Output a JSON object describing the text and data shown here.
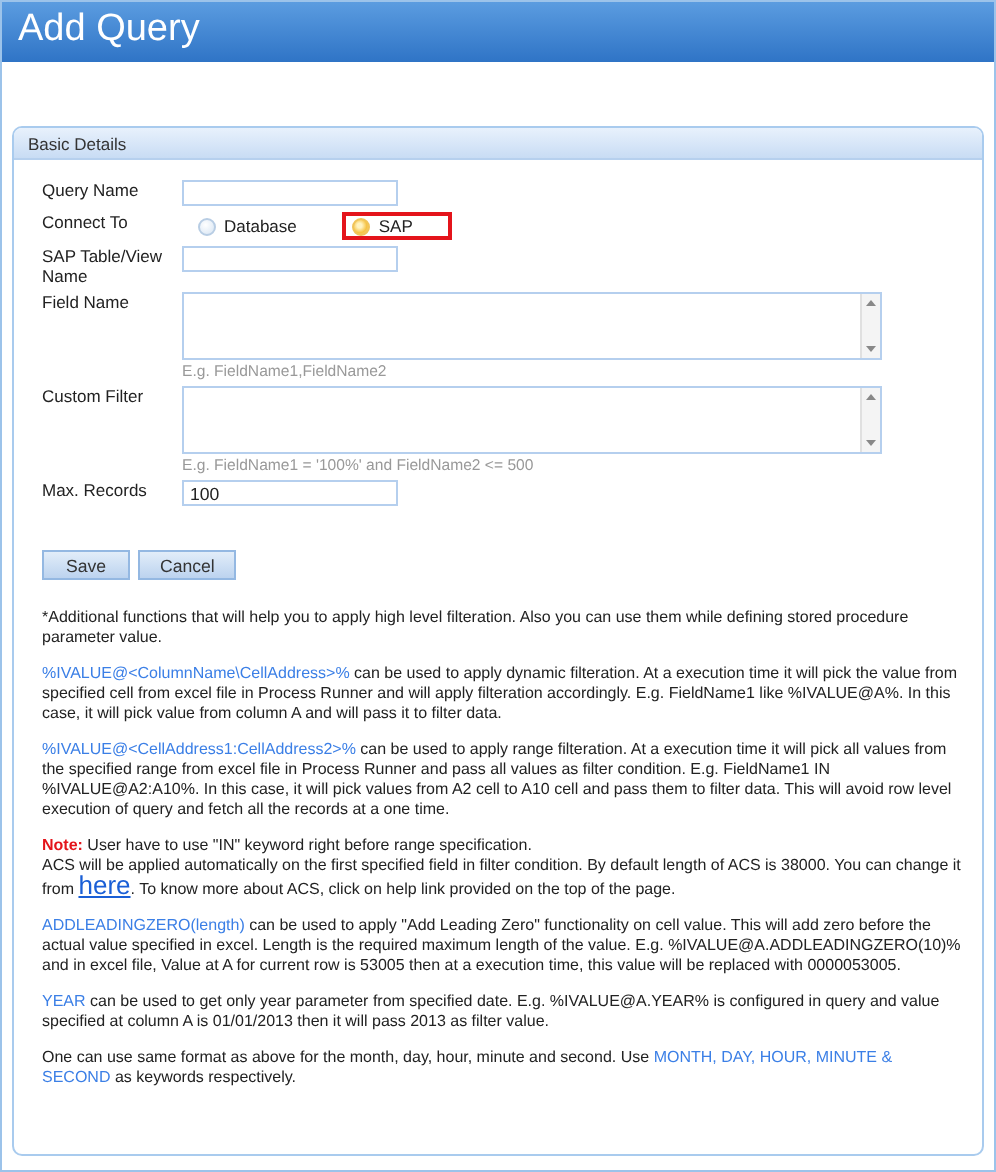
{
  "header": {
    "title": "Add Query"
  },
  "panel": {
    "title": "Basic Details"
  },
  "form": {
    "fields": [
      {
        "kind": "text",
        "label": "Query Name"
      },
      {
        "kind": "radio",
        "label": "Connect To",
        "options": [
          {
            "label": "Database",
            "selected": false,
            "highlighted": false
          },
          {
            "label": "SAP",
            "selected": true,
            "highlighted": true
          }
        ]
      },
      {
        "kind": "text",
        "label": "SAP Table/View Name"
      },
      {
        "kind": "textarea",
        "label": "Field Name",
        "hint": "E.g. FieldName1,FieldName2"
      },
      {
        "kind": "textarea",
        "label": "Custom Filter",
        "hint": "E.g. FieldName1 = '100%' and FieldName2 <= 500"
      },
      {
        "kind": "text",
        "label": "Max. Records",
        "value": "100"
      }
    ],
    "buttons": [
      "Save",
      "Cancel"
    ]
  },
  "notes": [
    {
      "segments": [
        {
          "kind": "plain",
          "text": "*Additional functions that will help you to apply high level filteration. Also you can use them while defining stored procedure parameter value."
        }
      ]
    },
    {
      "segments": [
        {
          "kind": "keyword",
          "text": "%IVALUE@<ColumnName\\CellAddress>%"
        },
        {
          "kind": "plain",
          "text": " can be used to apply dynamic filteration. At a execution time it will pick the value from specified cell from excel file in Process Runner and will apply filteration accordingly. E.g. FieldName1 like %IVALUE@A%. In this case, it will pick value from column A and will pass it to filter data."
        }
      ]
    },
    {
      "segments": [
        {
          "kind": "keyword",
          "text": "%IVALUE@<CellAddress1:CellAddress2>%"
        },
        {
          "kind": "plain",
          "text": " can be used to apply range filteration. At a execution time it will pick all values from the specified range from excel file in Process Runner and pass all values as filter condition. E.g. FieldName1 IN %IVALUE@A2:A10%. In this case, it will pick values from A2 cell to A10 cell and pass them to filter data. This will avoid row level execution of query and fetch all the records at a one time."
        }
      ]
    },
    {
      "segments": [
        {
          "kind": "note",
          "text": "Note:"
        },
        {
          "kind": "plain",
          "text": " User have to use \"IN\" keyword right before range specification."
        },
        {
          "kind": "break"
        },
        {
          "kind": "plain",
          "text": "ACS will be applied automatically on the first specified field in filter condition. By default length of ACS is 38000. You can change it from "
        },
        {
          "kind": "link",
          "text": "here"
        },
        {
          "kind": "plain",
          "text": ". To know more about ACS, click on help link provided on the top of the page."
        }
      ]
    },
    {
      "segments": [
        {
          "kind": "keyword",
          "text": "ADDLEADINGZERO(length)"
        },
        {
          "kind": "plain",
          "text": " can be used to apply \"Add Leading Zero\" functionality on cell value. This will add zero before the actual value specified in excel. Length is the required maximum length of the value. E.g. %IVALUE@A.ADDLEADINGZERO(10)% and in excel file, Value at A for current row is 53005 then at a execution time, this value will be replaced with 0000053005."
        }
      ]
    },
    {
      "segments": [
        {
          "kind": "keyword",
          "text": "YEAR"
        },
        {
          "kind": "plain",
          "text": " can be used to get only year parameter from specified date. E.g. %IVALUE@A.YEAR% is configured in query and value specified at column A is 01/01/2013 then it will pass 2013 as filter value."
        }
      ]
    },
    {
      "segments": [
        {
          "kind": "plain",
          "text": "One can use same format as above for the month, day, hour, minute and second. Use "
        },
        {
          "kind": "keyword",
          "text": "MONTH, DAY, HOUR, MINUTE & SECOND"
        },
        {
          "kind": "plain",
          "text": " as keywords respectively."
        }
      ]
    }
  ]
}
